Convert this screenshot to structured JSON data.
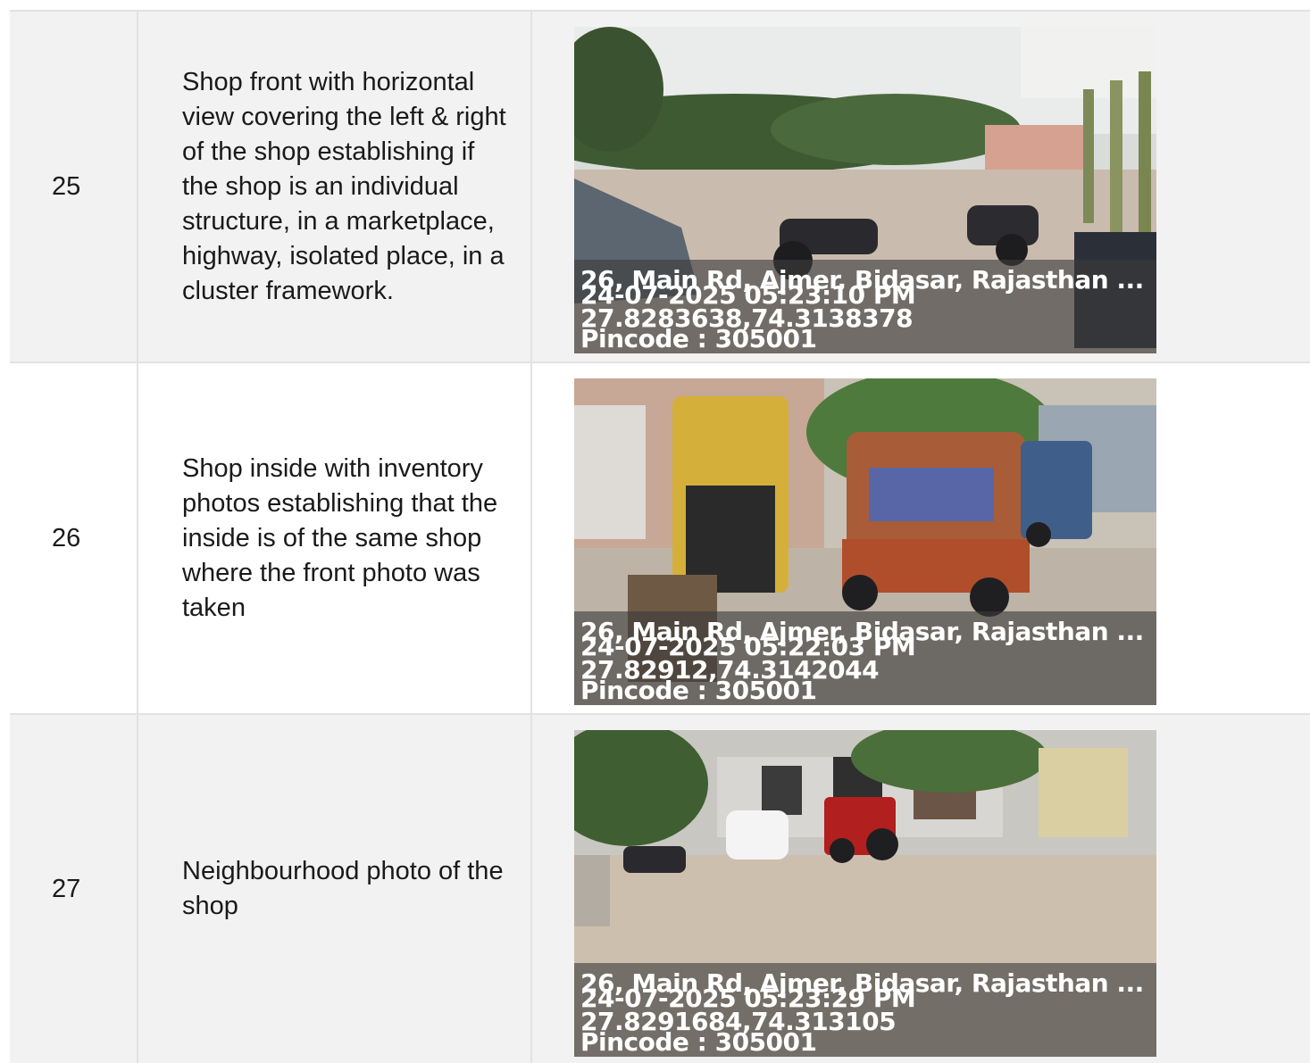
{
  "rows": [
    {
      "number": "25",
      "description": "Shop front with horizontal view covering the left & right of the shop establishing if the shop is an individual structure, in a marketplace, highway, isolated place, in a cluster framework.",
      "photo": {
        "address": "26, Main Rd, Ajmer, Bidasar, Rajasthan ...",
        "datetime": "24-07-2025 05:23:10 PM",
        "coordinates": "27.8283638,74.3138378",
        "pincode": "Pincode : 305001"
      }
    },
    {
      "number": "26",
      "description": "Shop inside with inventory photos establishing that the inside is of the same shop where the front photo was taken",
      "photo": {
        "address": "26, Main Rd, Ajmer, Bidasar, Rajasthan ...",
        "datetime": "24-07-2025 05:22:03 PM",
        "coordinates": "27.82912,74.3142044",
        "pincode": "Pincode : 305001"
      }
    },
    {
      "number": "27",
      "description": "Neighbourhood photo of the shop",
      "photo": {
        "address": "26, Main Rd, Ajmer, Bidasar, Rajasthan ...",
        "datetime": "24-07-2025 05:23:29 PM",
        "coordinates": "27.8291684,74.313105",
        "pincode": "Pincode : 305001"
      }
    }
  ]
}
